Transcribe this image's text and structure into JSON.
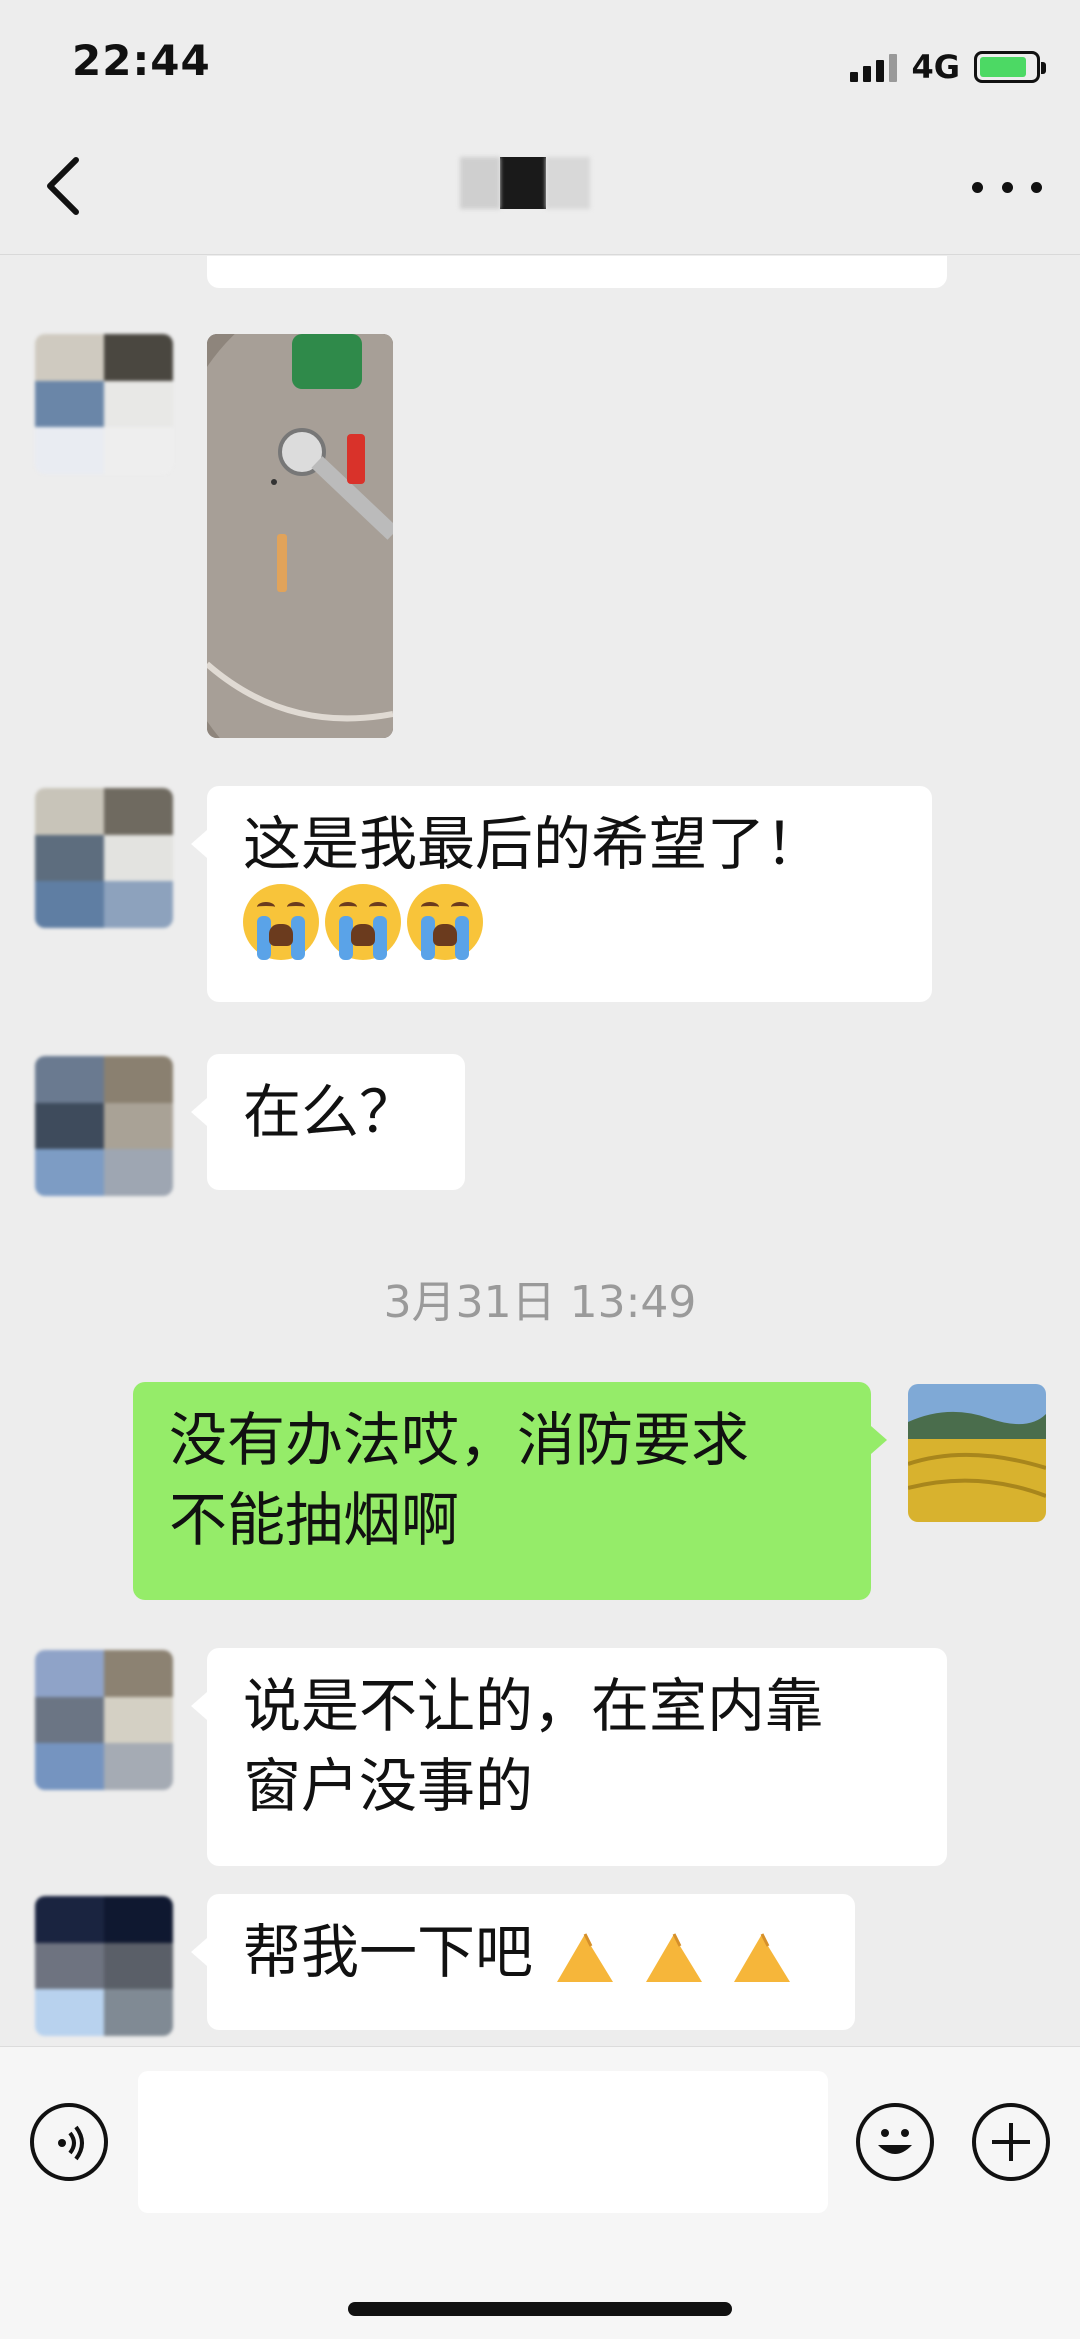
{
  "status_bar": {
    "time": "22:44",
    "network": "4G",
    "battery": "charging"
  },
  "nav": {
    "back_icon": "chevron-left-icon",
    "more_icon": "ellipsis-icon"
  },
  "messages": [
    {
      "from": "other",
      "type": "image",
      "description_icon": "photo-thumbnail"
    },
    {
      "from": "other",
      "type": "text",
      "line1": "这是我最后的希望了！",
      "emoji": "loudly-crying-face",
      "emoji_count": 3
    },
    {
      "from": "other",
      "type": "text",
      "text": "在么？"
    },
    {
      "type": "timestamp",
      "text": "3月31日 13:49"
    },
    {
      "from": "me",
      "type": "text",
      "line1": "没有办法哎，消防要求",
      "line2": "不能抽烟啊"
    },
    {
      "from": "other",
      "type": "text",
      "line1": "说是不让的，在室内靠",
      "line2": "窗户没事的"
    },
    {
      "from": "other",
      "type": "text",
      "text": "帮我一下吧",
      "emoji": "folded-hands",
      "emoji_count": 3
    }
  ],
  "input_bar": {
    "voice_icon": "voice-icon",
    "input_value": "",
    "emoji_icon": "smiley-icon",
    "plus_icon": "plus-circle-icon"
  },
  "colors": {
    "background": "#ededed",
    "my_bubble": "#95ec69",
    "other_bubble": "#ffffff",
    "timestamp": "#9a9a9a"
  }
}
